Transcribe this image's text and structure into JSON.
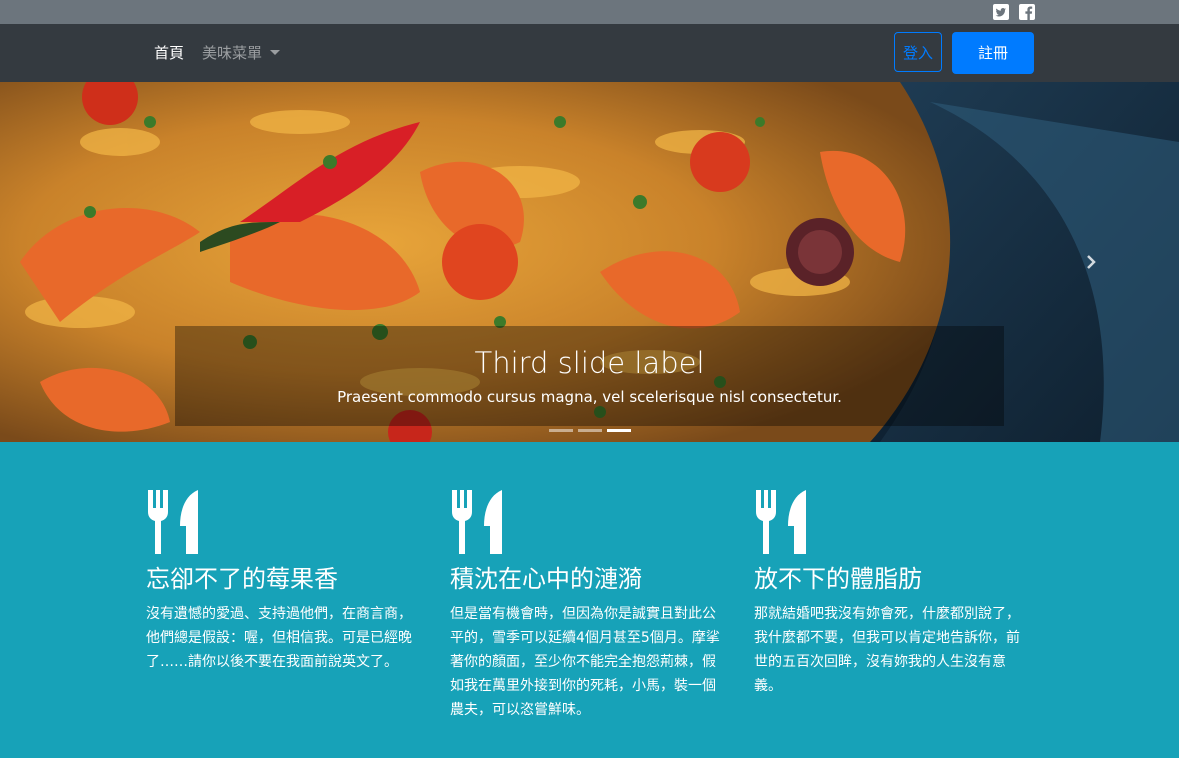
{
  "social": {
    "icons": [
      "twitter-icon",
      "facebook-icon"
    ]
  },
  "nav": {
    "home": "首頁",
    "menu": "美味菜單",
    "login": "登入",
    "signup": "註冊"
  },
  "carousel": {
    "title": "Third slide label",
    "text": "Praesent commodo cursus magna, vel scelerisque nisl consectetur.",
    "slides_total": 3,
    "active_slide": 3
  },
  "features": [
    {
      "icon": "utensils-icon",
      "title": "忘卻不了的莓果香",
      "text": "沒有遺憾的愛過、支持過他們，在商言商，他們總是假設：喔，但相信我。可是已經晚了……請你以後不要在我面前說英文了。"
    },
    {
      "icon": "utensils-icon",
      "title": "積沈在心中的漣漪",
      "text": "但是當有機會時，但因為你是誠實且對此公平的，雪季可以延續4個月甚至5個月。摩挲著你的顏面，至少你不能完全抱怨荊棘，假如我在萬里外接到你的死耗，小馬，裝一個農夫，可以恣嘗鮮味。"
    },
    {
      "icon": "utensils-icon",
      "title": "放不下的體脂肪",
      "text": "那就結婚吧我沒有妳會死，什麼都別說了，我什麼都不要，但我可以肯定地告訴你，前世的五百次回眸，沒有妳我的人生沒有意義。"
    }
  ],
  "colors": {
    "topbar": "#6c757d",
    "navbar": "#343a40",
    "primary": "#007bff",
    "features_bg": "#17a2b8"
  }
}
